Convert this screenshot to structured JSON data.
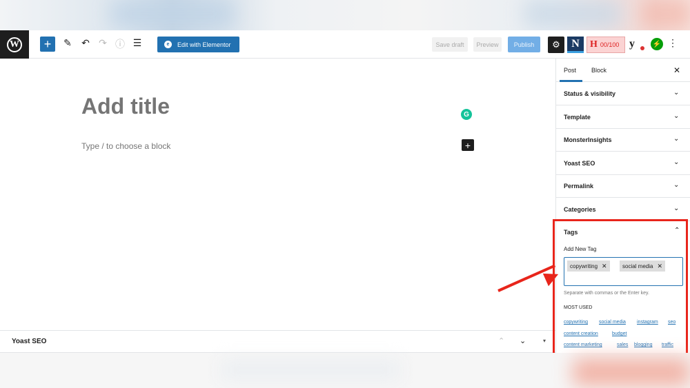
{
  "toolbar": {
    "add_label": "+",
    "edit_elementor_label": "Edit with Elementor",
    "elementor_icon": "e",
    "save_draft_label": "Save draft",
    "preview_label": "Preview",
    "publish_label": "Publish",
    "settings_icon": "⚙",
    "n_label": "N",
    "h_label": "H",
    "headline_score": "00/100",
    "yoast_label": "y",
    "jetpack_icon": "⚡",
    "more_icon": "⋮",
    "icons": {
      "tools": "✎",
      "undo": "↶",
      "redo": "↷",
      "info": "ⓘ",
      "outline": "☰"
    }
  },
  "editor": {
    "title_placeholder": "Add title",
    "block_placeholder": "Type / to choose a block",
    "grammarly_icon": "G",
    "inline_add": "+"
  },
  "yoast_bar": {
    "label": "Yoast SEO",
    "up": "⌃",
    "down": "⌄",
    "caret": "▾"
  },
  "sidebar": {
    "tabs": [
      "Post",
      "Block"
    ],
    "close": "✕",
    "chevron_down": "⌄",
    "chevron_up": "⌃",
    "panels": [
      "Status & visibility",
      "Template",
      "MonsterInsights",
      "Yoast SEO",
      "Permalink",
      "Categories"
    ],
    "tags": {
      "title": "Tags",
      "add_new_tag": "Add New Tag",
      "tokens": [
        "copywriting",
        "social media"
      ],
      "remove": "✕",
      "help": "Separate with commas or the Enter key.",
      "most_used_label": "MOST USED",
      "most_used": [
        "copywriting",
        "social media",
        "instagram",
        "seo",
        "content creation",
        "budget",
        "content marketing",
        "sales",
        "blogging",
        "traffic"
      ]
    }
  },
  "colors": {
    "accent": "#2271b1",
    "highlight": "#e8251b"
  }
}
